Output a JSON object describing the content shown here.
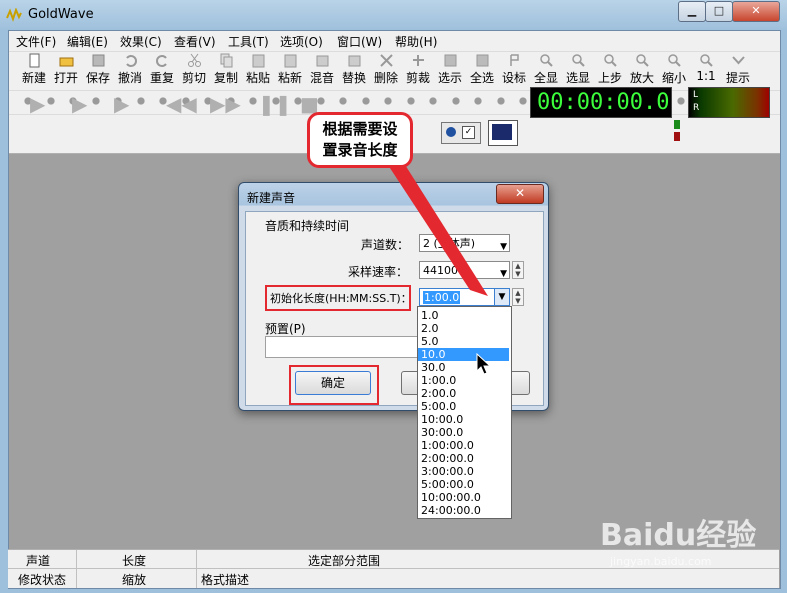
{
  "window": {
    "title": "GoldWave",
    "minimize_glyph": "▁",
    "maximize_glyph": "□",
    "close_glyph": "✕"
  },
  "menu": [
    "文件(F)",
    "编辑(E)",
    "效果(C)",
    "查看(V)",
    "工具(T)",
    "选项(O)",
    "窗口(W)",
    "帮助(H)"
  ],
  "toolbar": [
    "新建",
    "打开",
    "保存",
    "撤消",
    "重复",
    "剪切",
    "复制",
    "粘贴",
    "粘新",
    "混音",
    "替换",
    "删除",
    "剪裁",
    "选示",
    "全选",
    "设标",
    "全显",
    "选显",
    "上步",
    "放大",
    "缩小",
    "1:1",
    "提示"
  ],
  "playbar": {
    "time": "00:00:00.0",
    "channel_left": "L",
    "channel_right": "R"
  },
  "callout": {
    "line1": "根据需要设",
    "line2": "置录音长度"
  },
  "dialog": {
    "title": "新建声音",
    "close_glyph": "✕",
    "group_label": "音质和持续时间",
    "channels_label": "声道数：",
    "channels_value": "2 (立体声)",
    "sample_rate_label": "采样速率：",
    "sample_rate_value": "44100",
    "length_label": "初始化长度(HH:MM:SS.T)：",
    "length_value": "1:00.0",
    "preset_label": "预置(P)",
    "ok_button": "确定",
    "cancel_button": "取消"
  },
  "length_options": [
    "1.0",
    "2.0",
    "5.0",
    "10.0",
    "30.0",
    "1:00.0",
    "2:00.0",
    "5:00.0",
    "10:00.0",
    "30:00.0",
    "1:00:00.0",
    "2:00:00.0",
    "3:00:00.0",
    "5:00:00.0",
    "10:00:00.0",
    "24:00:00.0"
  ],
  "length_selected": "10.0",
  "status": {
    "row1": [
      "声道",
      "长度",
      "选定部分范围"
    ],
    "row2": [
      "修改状态",
      "缩放",
      "格式描述"
    ]
  },
  "watermark": {
    "brand": "Baidu经验",
    "url": "jingyan.baidu.com"
  },
  "colors": {
    "accent_red": "#e3282f",
    "selection_blue": "#3399ff",
    "timer_green": "#3cff3c"
  }
}
